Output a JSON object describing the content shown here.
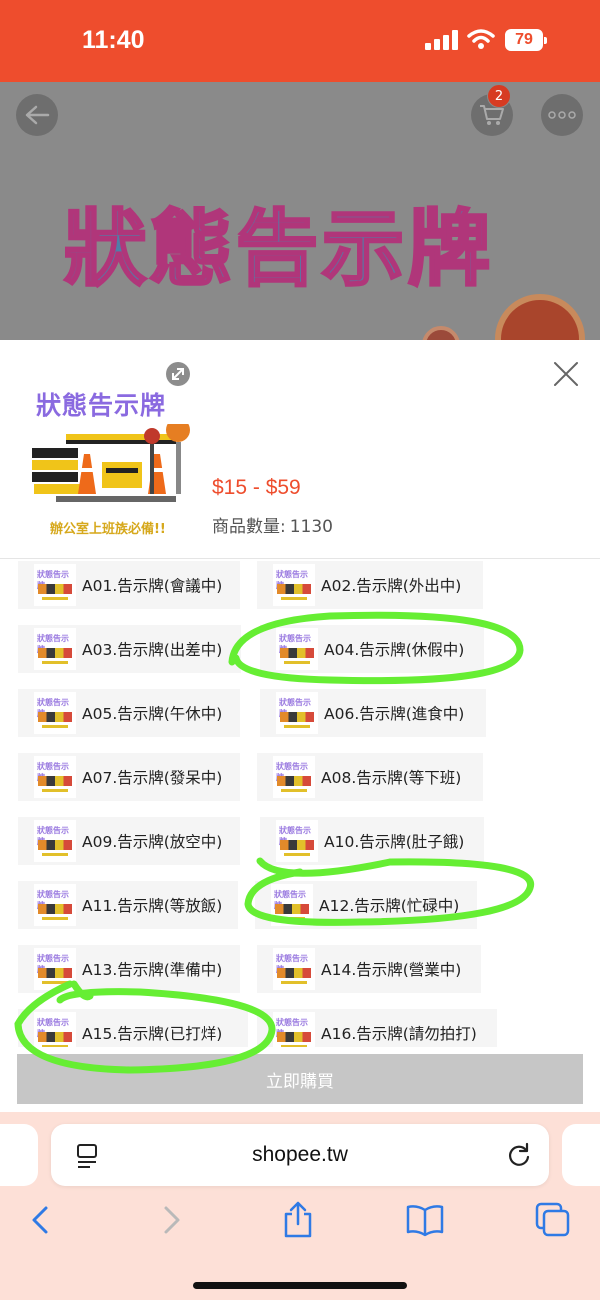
{
  "status_bar": {
    "time": "11:40",
    "battery": "79"
  },
  "product_page": {
    "hero_title": "狀態告示牌",
    "cart_count": "2"
  },
  "sheet": {
    "thumb_title": "狀態告示牌",
    "thumb_subtitle": "辦公室上班族必備!!",
    "price_range": "$15 - $59",
    "stock_label": "商品數量:",
    "stock_value": "1130",
    "options": [
      {
        "label": "A01.告示牌(會議中)"
      },
      {
        "label": "A02.告示牌(外出中)"
      },
      {
        "label": "A03.告示牌(出差中)"
      },
      {
        "label": "A04.告示牌(休假中)"
      },
      {
        "label": "A05.告示牌(午休中)"
      },
      {
        "label": "A06.告示牌(進食中)"
      },
      {
        "label": "A07.告示牌(發呆中)"
      },
      {
        "label": "A08.告示牌(等下班)"
      },
      {
        "label": "A09.告示牌(放空中)"
      },
      {
        "label": "A10.告示牌(肚子餓)"
      },
      {
        "label": "A11.告示牌(等放飯)"
      },
      {
        "label": "A12.告示牌(忙碌中)"
      },
      {
        "label": "A13.告示牌(準備中)"
      },
      {
        "label": "A14.告示牌(營業中)"
      },
      {
        "label": "A15.告示牌(已打烊)"
      },
      {
        "label": "A16.告示牌(請勿拍打)"
      }
    ],
    "buy_button": "立即購買"
  },
  "browser": {
    "url": "shopee.tw"
  },
  "colors": {
    "brand": "#ee4d2d",
    "annotation": "#66ee33"
  }
}
